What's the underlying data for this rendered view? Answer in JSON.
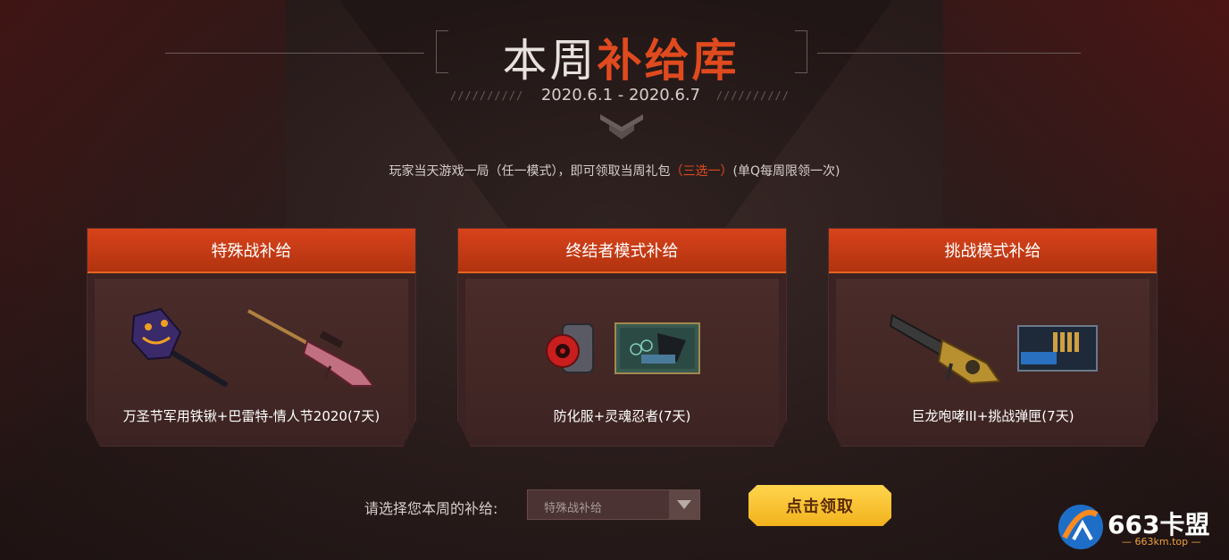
{
  "header": {
    "title_part1": "本周",
    "title_part2": "补给库",
    "date_range": "2020.6.1 - 2020.6.7",
    "slashes": "//////////"
  },
  "notice": {
    "before": "玩家当天游戏一局（任一模式），即可领取当周礼包",
    "highlight": "（三选一）",
    "after": "(单Q每周限领一次)"
  },
  "cards": [
    {
      "title": "特殊战补给",
      "items": [
        "halloween-shovel",
        "barrett-valentine-rifle"
      ],
      "label": "万圣节军用铁锹+巴雷特-情人节2020(7天)"
    },
    {
      "title": "终结者模式补给",
      "items": [
        "hazmat-suit",
        "soul-ninja-card"
      ],
      "label": "防化服+灵魂忍者(7天)"
    },
    {
      "title": "挑战模式补给",
      "items": [
        "dragon-roar-iii-gatling",
        "challenge-ammo-box"
      ],
      "label": "巨龙咆哮III+挑战弹匣(7天)"
    }
  ],
  "controls": {
    "choose_label": "请选择您本周的补给:",
    "select_value": "特殊战补给",
    "claim_button": "点击领取"
  },
  "watermark": {
    "text": "663卡盟",
    "sub": "— 663km.top —"
  },
  "colors": {
    "accent": "#e04a1f",
    "card_header": "#c63a14",
    "button": "#f5b923"
  }
}
